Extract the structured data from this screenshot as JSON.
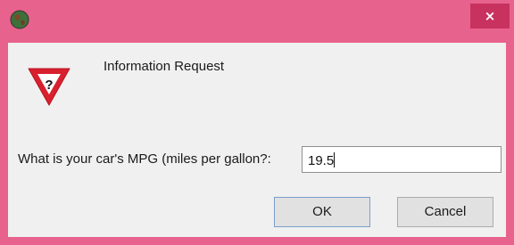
{
  "window": {
    "app_icon": "app-globe-icon",
    "close_label": "×",
    "colors": {
      "titlebar": "#e8628e",
      "close_button": "#c8325f",
      "client": "#f0f0f0",
      "warning_red": "#d8202e"
    }
  },
  "dialog": {
    "icon": "question-warning-icon",
    "icon_glyph": "?",
    "heading": "Information Request",
    "prompt": "What is your car's MPG (miles per gallon?:",
    "input_value": "19.5",
    "ok_label": "OK",
    "cancel_label": "Cancel"
  }
}
